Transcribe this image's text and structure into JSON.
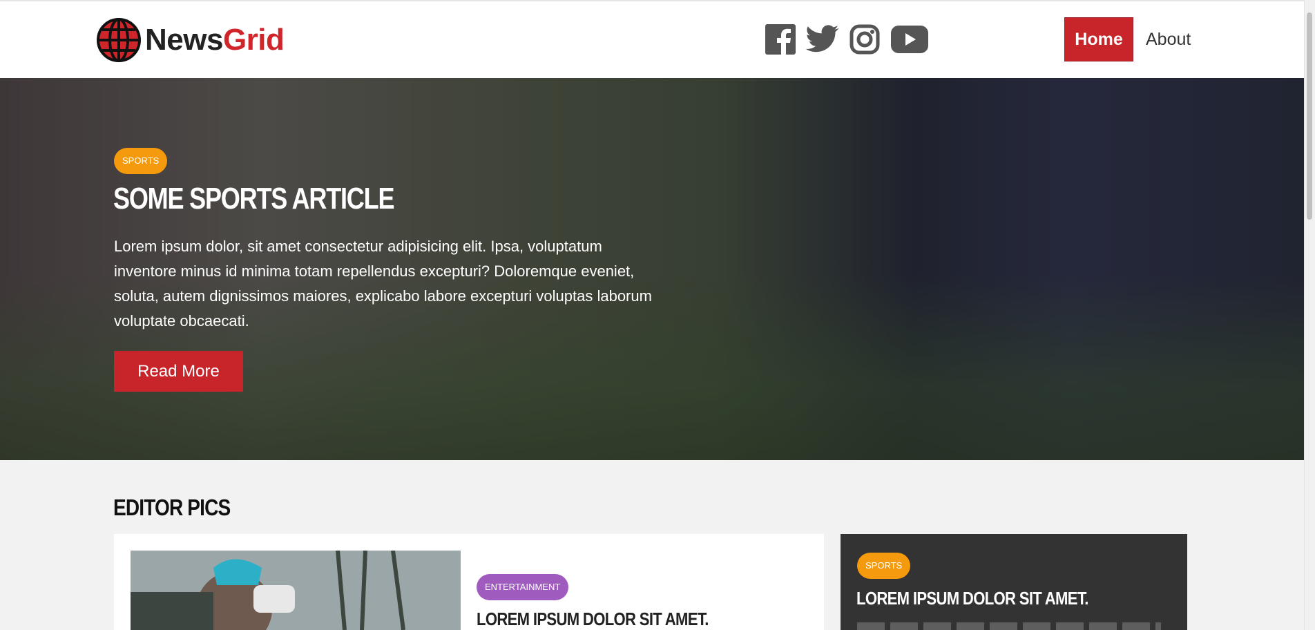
{
  "brand": {
    "name_part1": "News",
    "name_part2": "Grid",
    "accent": "#d0262b"
  },
  "social": [
    {
      "name": "facebook-icon"
    },
    {
      "name": "twitter-icon"
    },
    {
      "name": "instagram-icon"
    },
    {
      "name": "youtube-icon"
    }
  ],
  "nav": {
    "home": "Home",
    "about": "About"
  },
  "hero": {
    "category": "SPORTS",
    "title": "SOME SPORTS ARTICLE",
    "text": "Lorem ipsum dolor, sit amet consectetur adipisicing elit. Ipsa, voluptatum inventore minus id minima totam repellendus excepturi? Doloremque eveniet, soluta, autem dignissimos maiores, explicabo labore excepturi voluptas laborum voluptate obcaecati.",
    "button": "Read More"
  },
  "editor_pics": {
    "title": "EDITOR PICS",
    "main_card": {
      "category": "ENTERTAINMENT",
      "title": "LOREM IPSUM DOLOR SIT AMET."
    },
    "side_card": {
      "category": "SPORTS",
      "title": "LOREM IPSUM DOLOR SIT AMET."
    }
  },
  "colors": {
    "sports_badge": "#f59a0c",
    "entertainment_badge": "#a05bbf",
    "primary_button": "#c8252a",
    "dark_card": "#333333"
  }
}
